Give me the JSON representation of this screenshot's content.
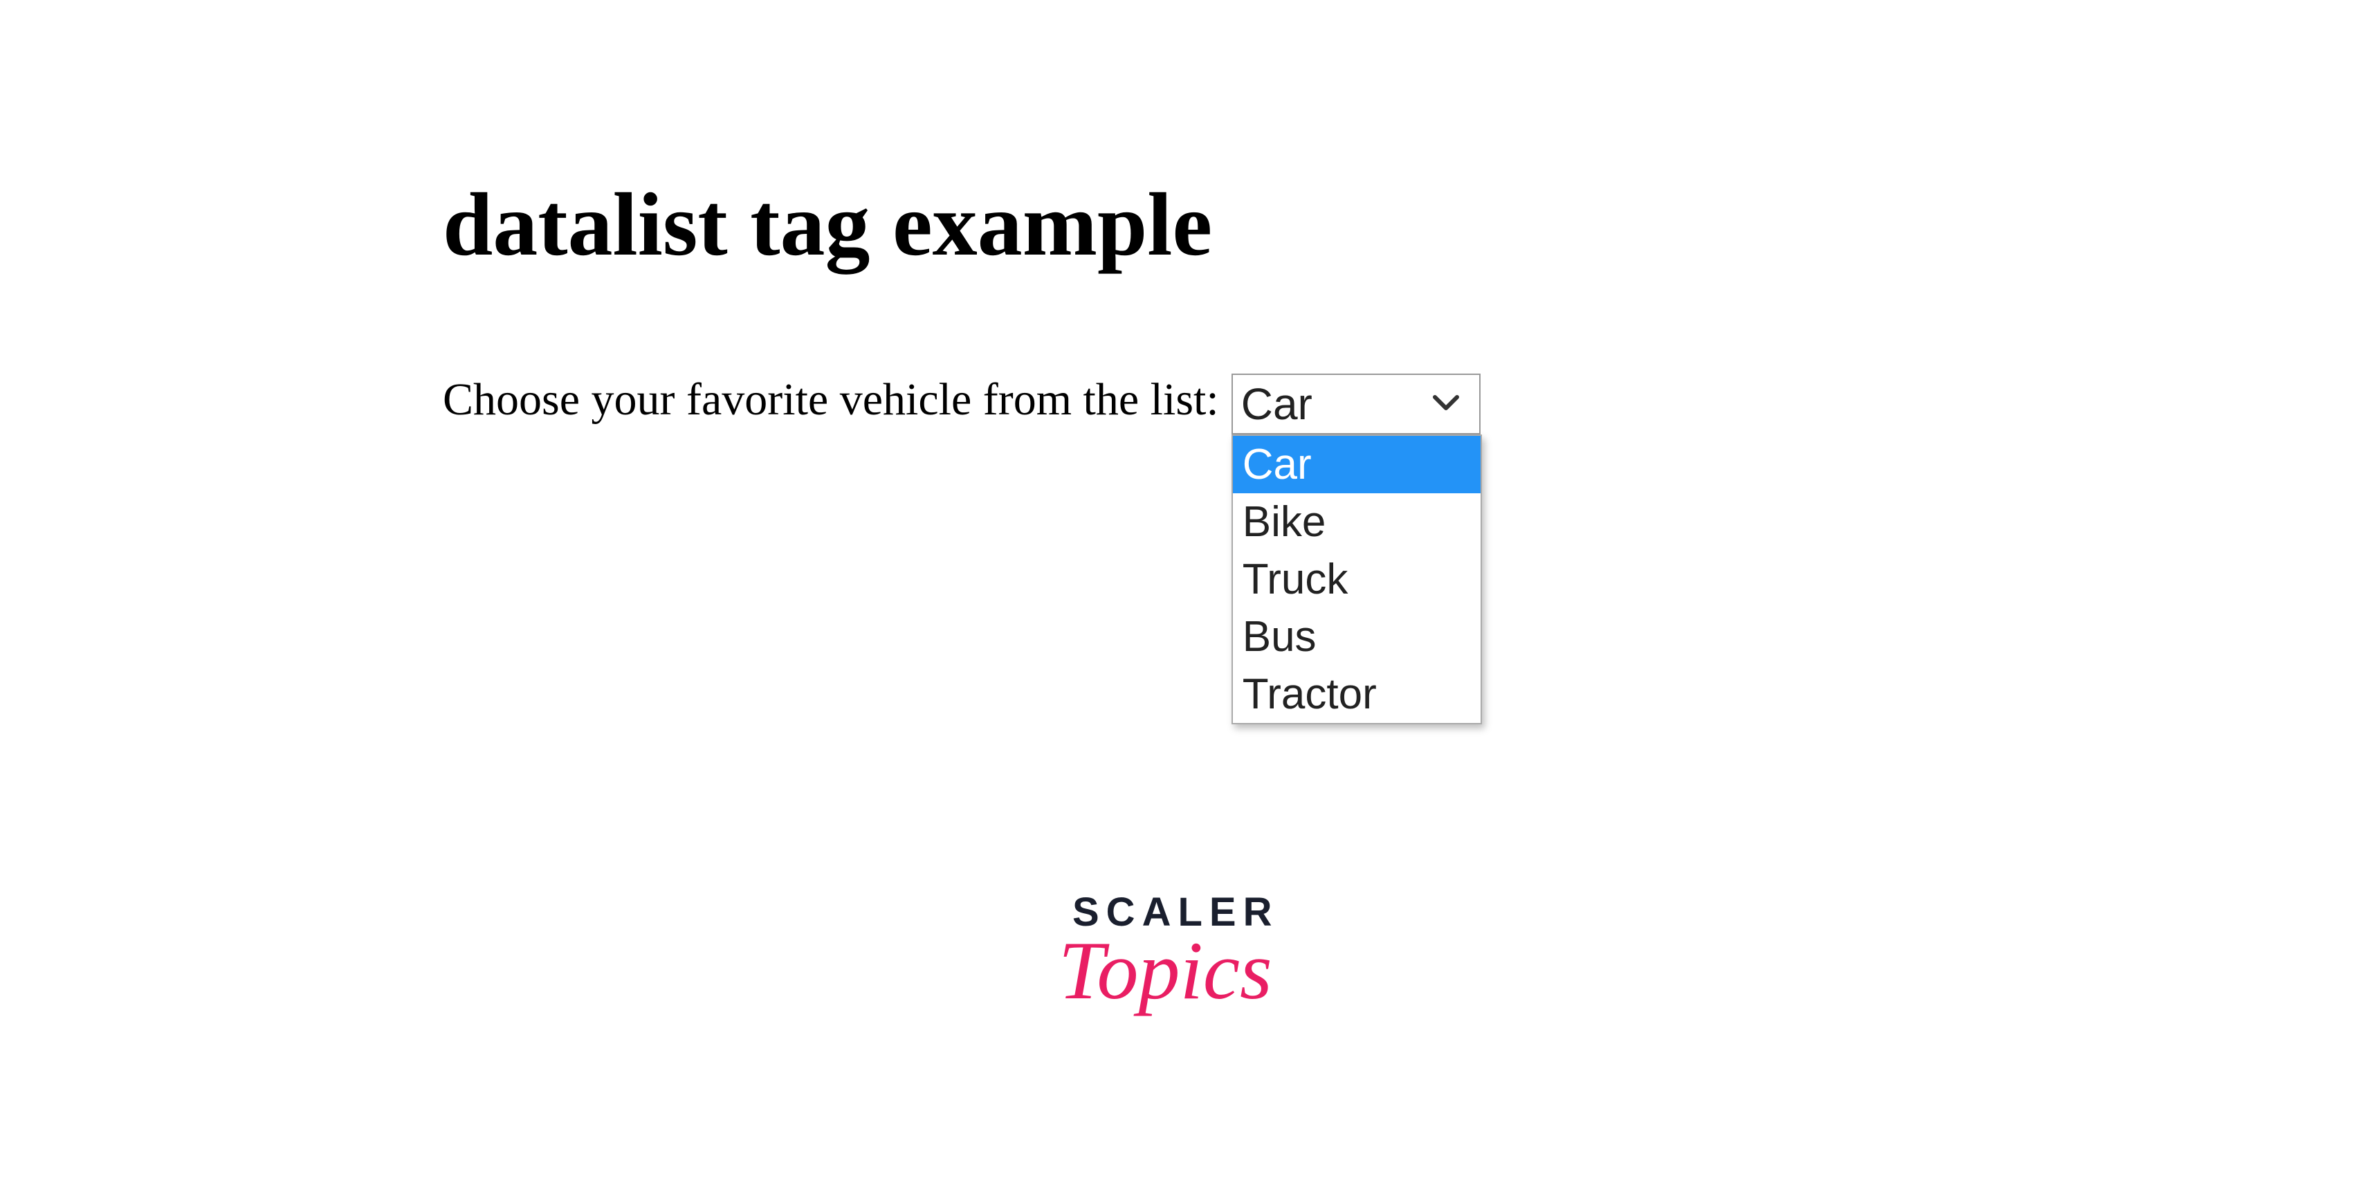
{
  "heading": "datalist tag example",
  "label": "Choose your favorite vehicle from the list:",
  "input": {
    "value": "Car"
  },
  "options": [
    {
      "label": "Car",
      "selected": true
    },
    {
      "label": "Bike",
      "selected": false
    },
    {
      "label": "Truck",
      "selected": false
    },
    {
      "label": "Bus",
      "selected": false
    },
    {
      "label": "Tractor",
      "selected": false
    }
  ],
  "brand": {
    "top": "SCALER",
    "bottom": "Topics"
  }
}
